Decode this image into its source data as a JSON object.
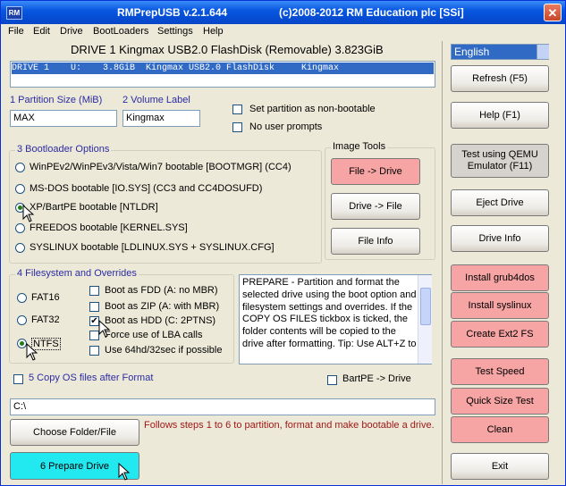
{
  "window": {
    "app_title": "RMPrepUSB v.2.1.644",
    "copyright": "(c)2008-2012 RM Education plc [SSi]",
    "icon_text": "RM",
    "close_glyph": "✕"
  },
  "menu": [
    "File",
    "Edit",
    "Drive",
    "BootLoaders",
    "Settings",
    "Help"
  ],
  "drive_header": "DRIVE 1  Kingmax USB2.0 FlashDisk  (Removable) 3.823GiB",
  "drive_list": {
    "selected_row": "DRIVE 1    U:    3.8GiB  Kingmax USB2.0 FlashDisk     Kingmax"
  },
  "language": {
    "value": "English"
  },
  "partition": {
    "size_label": "1 Partition Size (MiB)",
    "size_value": "MAX",
    "volume_label": "2 Volume Label",
    "volume_value": "Kingmax",
    "non_bootable": "Set partition as non-bootable",
    "no_prompts": "No user prompts"
  },
  "bootloader": {
    "title": "3 Bootloader Options",
    "options": [
      "WinPEv2/WinPEv3/Vista/Win7 bootable [BOOTMGR] (CC4)",
      "MS-DOS bootable [IO.SYS]      (CC3 and CC4DOSUFD)",
      "XP/BartPE bootable [NTLDR]",
      "FREEDOS bootable [KERNEL.SYS]",
      "SYSLINUX bootable [LDLINUX.SYS + SYSLINUX.CFG]"
    ],
    "selected_index": 2
  },
  "image_tools": {
    "title": "Image Tools",
    "file_to_drive": "File -> Drive",
    "drive_to_file": "Drive -> File",
    "file_info": "File Info"
  },
  "filesystem": {
    "title": "4 Filesystem and Overrides",
    "fs": [
      "FAT16",
      "FAT32",
      "NTFS"
    ],
    "selected_fs": 2,
    "overrides": [
      {
        "label": "Boot as FDD (A: no MBR)",
        "checked": false
      },
      {
        "label": "Boot as ZIP (A: with MBR)",
        "checked": false
      },
      {
        "label": "Boot as HDD (C: 2PTNS)",
        "checked": true
      },
      {
        "label": "Force use of LBA calls",
        "checked": false
      },
      {
        "label": "Use 64hd/32sec if possible",
        "checked": false
      }
    ],
    "check_glyph": "✔"
  },
  "info_text": "PREPARE - Partition and format the selected drive using the boot option and filesystem settings and overrides. If the COPY OS FILES tickbox is ticked, the folder contents will be copied to the drive after formatting. Tip: Use ALT+Z to",
  "copy_os": {
    "label": "5 Copy OS files after Format",
    "bartpe": "BartPE -> Drive"
  },
  "path_value": "C:\\",
  "buttons": {
    "choose_folder": "Choose Folder/File",
    "prepare_drive": "6 Prepare Drive",
    "steps_hint": "Follows steps 1 to 6 to partition, format and make bootable a drive.",
    "refresh": "Refresh (F5)",
    "help": "Help (F1)",
    "qemu": "Test using QEMU Emulator (F11)",
    "eject": "Eject Drive",
    "drive_info": "Drive Info",
    "grub4dos": "Install grub4dos",
    "syslinux": "Install syslinux",
    "ext2": "Create Ext2 FS",
    "speed": "Test Speed",
    "quick_size": "Quick Size Test",
    "clean": "Clean",
    "exit": "Exit"
  }
}
